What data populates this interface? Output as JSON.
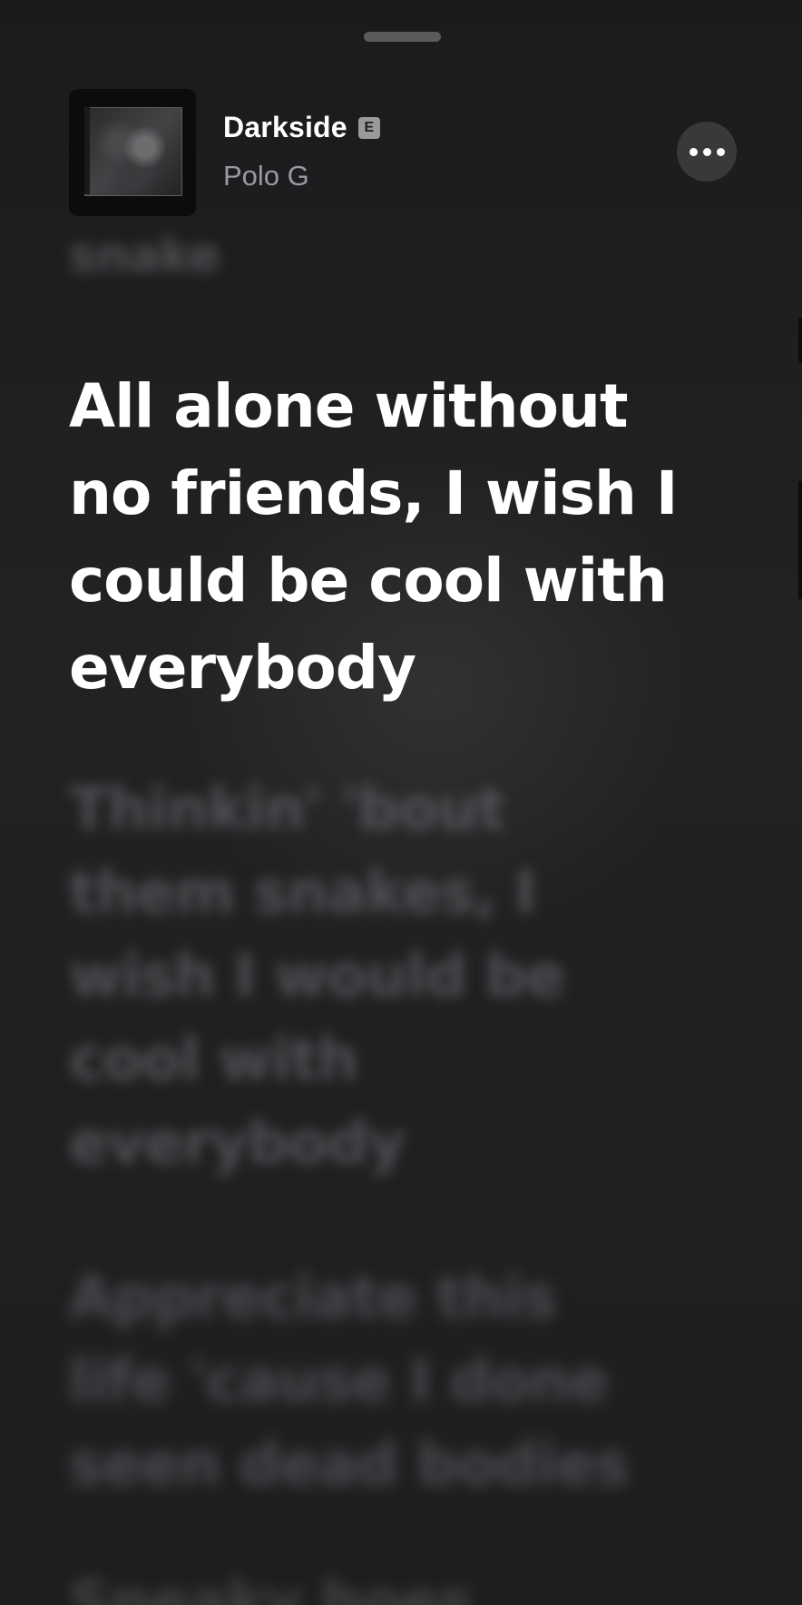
{
  "now_playing": {
    "title": "Darkside",
    "explicit_label": "E",
    "artist": "Polo G",
    "artwork_icon": "album-artwork",
    "more_icon": "ellipsis-icon"
  },
  "lyrics": {
    "previous": [
      "snake"
    ],
    "current": [
      "All alone without",
      "no friends, I wish I",
      "could be cool with",
      "everybody"
    ],
    "next": [
      "Thinkin' 'bout",
      "them snakes, I",
      "wish I would be",
      "cool with",
      "everybody"
    ],
    "next_2": [
      "Appreciate this",
      "life 'cause I done",
      "seen dead bodies"
    ],
    "next_3": [
      "Sneaky hoes"
    ]
  },
  "colors": {
    "background": "#1e1e20",
    "active_lyric": "#ffffff",
    "inactive_lyric": "#707074",
    "artist_text": "#9a9a9e",
    "more_button_bg": "#39393c"
  }
}
